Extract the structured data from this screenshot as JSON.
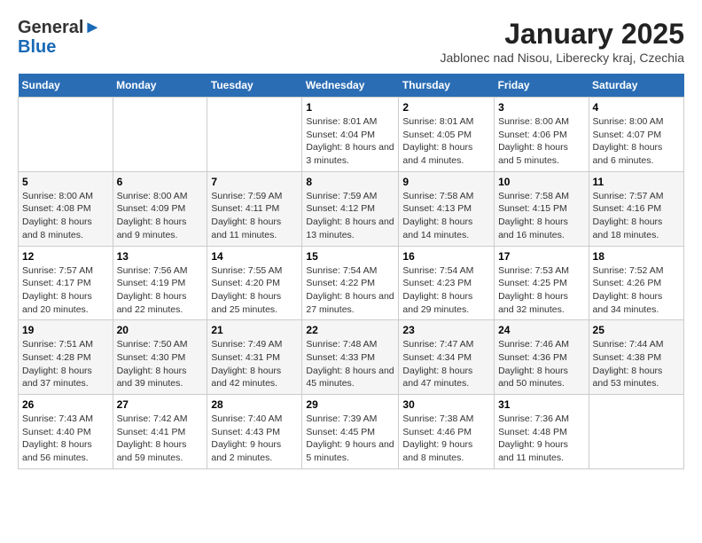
{
  "header": {
    "logo_general": "General",
    "logo_blue": "Blue",
    "month_title": "January 2025",
    "location": "Jablonec nad Nisou, Liberecky kraj, Czechia"
  },
  "weekdays": [
    "Sunday",
    "Monday",
    "Tuesday",
    "Wednesday",
    "Thursday",
    "Friday",
    "Saturday"
  ],
  "weeks": [
    [
      {
        "day": "",
        "info": ""
      },
      {
        "day": "",
        "info": ""
      },
      {
        "day": "",
        "info": ""
      },
      {
        "day": "1",
        "info": "Sunrise: 8:01 AM\nSunset: 4:04 PM\nDaylight: 8 hours and 3 minutes."
      },
      {
        "day": "2",
        "info": "Sunrise: 8:01 AM\nSunset: 4:05 PM\nDaylight: 8 hours and 4 minutes."
      },
      {
        "day": "3",
        "info": "Sunrise: 8:00 AM\nSunset: 4:06 PM\nDaylight: 8 hours and 5 minutes."
      },
      {
        "day": "4",
        "info": "Sunrise: 8:00 AM\nSunset: 4:07 PM\nDaylight: 8 hours and 6 minutes."
      }
    ],
    [
      {
        "day": "5",
        "info": "Sunrise: 8:00 AM\nSunset: 4:08 PM\nDaylight: 8 hours and 8 minutes."
      },
      {
        "day": "6",
        "info": "Sunrise: 8:00 AM\nSunset: 4:09 PM\nDaylight: 8 hours and 9 minutes."
      },
      {
        "day": "7",
        "info": "Sunrise: 7:59 AM\nSunset: 4:11 PM\nDaylight: 8 hours and 11 minutes."
      },
      {
        "day": "8",
        "info": "Sunrise: 7:59 AM\nSunset: 4:12 PM\nDaylight: 8 hours and 13 minutes."
      },
      {
        "day": "9",
        "info": "Sunrise: 7:58 AM\nSunset: 4:13 PM\nDaylight: 8 hours and 14 minutes."
      },
      {
        "day": "10",
        "info": "Sunrise: 7:58 AM\nSunset: 4:15 PM\nDaylight: 8 hours and 16 minutes."
      },
      {
        "day": "11",
        "info": "Sunrise: 7:57 AM\nSunset: 4:16 PM\nDaylight: 8 hours and 18 minutes."
      }
    ],
    [
      {
        "day": "12",
        "info": "Sunrise: 7:57 AM\nSunset: 4:17 PM\nDaylight: 8 hours and 20 minutes."
      },
      {
        "day": "13",
        "info": "Sunrise: 7:56 AM\nSunset: 4:19 PM\nDaylight: 8 hours and 22 minutes."
      },
      {
        "day": "14",
        "info": "Sunrise: 7:55 AM\nSunset: 4:20 PM\nDaylight: 8 hours and 25 minutes."
      },
      {
        "day": "15",
        "info": "Sunrise: 7:54 AM\nSunset: 4:22 PM\nDaylight: 8 hours and 27 minutes."
      },
      {
        "day": "16",
        "info": "Sunrise: 7:54 AM\nSunset: 4:23 PM\nDaylight: 8 hours and 29 minutes."
      },
      {
        "day": "17",
        "info": "Sunrise: 7:53 AM\nSunset: 4:25 PM\nDaylight: 8 hours and 32 minutes."
      },
      {
        "day": "18",
        "info": "Sunrise: 7:52 AM\nSunset: 4:26 PM\nDaylight: 8 hours and 34 minutes."
      }
    ],
    [
      {
        "day": "19",
        "info": "Sunrise: 7:51 AM\nSunset: 4:28 PM\nDaylight: 8 hours and 37 minutes."
      },
      {
        "day": "20",
        "info": "Sunrise: 7:50 AM\nSunset: 4:30 PM\nDaylight: 8 hours and 39 minutes."
      },
      {
        "day": "21",
        "info": "Sunrise: 7:49 AM\nSunset: 4:31 PM\nDaylight: 8 hours and 42 minutes."
      },
      {
        "day": "22",
        "info": "Sunrise: 7:48 AM\nSunset: 4:33 PM\nDaylight: 8 hours and 45 minutes."
      },
      {
        "day": "23",
        "info": "Sunrise: 7:47 AM\nSunset: 4:34 PM\nDaylight: 8 hours and 47 minutes."
      },
      {
        "day": "24",
        "info": "Sunrise: 7:46 AM\nSunset: 4:36 PM\nDaylight: 8 hours and 50 minutes."
      },
      {
        "day": "25",
        "info": "Sunrise: 7:44 AM\nSunset: 4:38 PM\nDaylight: 8 hours and 53 minutes."
      }
    ],
    [
      {
        "day": "26",
        "info": "Sunrise: 7:43 AM\nSunset: 4:40 PM\nDaylight: 8 hours and 56 minutes."
      },
      {
        "day": "27",
        "info": "Sunrise: 7:42 AM\nSunset: 4:41 PM\nDaylight: 8 hours and 59 minutes."
      },
      {
        "day": "28",
        "info": "Sunrise: 7:40 AM\nSunset: 4:43 PM\nDaylight: 9 hours and 2 minutes."
      },
      {
        "day": "29",
        "info": "Sunrise: 7:39 AM\nSunset: 4:45 PM\nDaylight: 9 hours and 5 minutes."
      },
      {
        "day": "30",
        "info": "Sunrise: 7:38 AM\nSunset: 4:46 PM\nDaylight: 9 hours and 8 minutes."
      },
      {
        "day": "31",
        "info": "Sunrise: 7:36 AM\nSunset: 4:48 PM\nDaylight: 9 hours and 11 minutes."
      },
      {
        "day": "",
        "info": ""
      }
    ]
  ]
}
